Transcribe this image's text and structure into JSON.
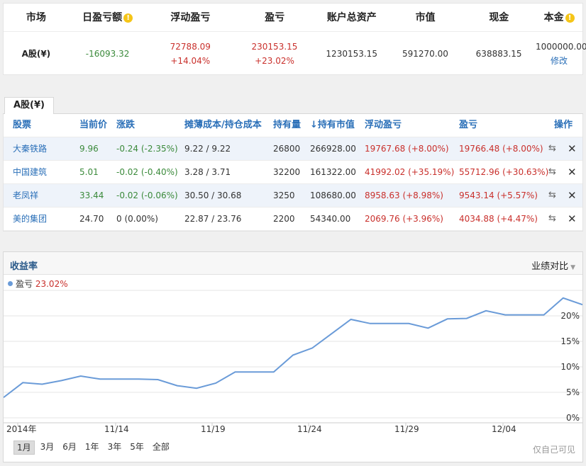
{
  "summary": {
    "headers": {
      "market": "市场",
      "daily_pl": "日盈亏额",
      "floating_pl": "浮动盈亏",
      "pl": "盈亏",
      "total_assets": "账户总资产",
      "market_value": "市值",
      "cash": "现金",
      "principal": "本金"
    },
    "info_icon": "!",
    "row": {
      "market": "A股(¥)",
      "daily_pl": "-16093.32",
      "floating_pl": "72788.09",
      "floating_pl_pct": "+14.04%",
      "pl": "230153.15",
      "pl_pct": "+23.02%",
      "total_assets": "1230153.15",
      "market_value": "591270.00",
      "cash": "638883.15",
      "principal": "1000000.00",
      "edit": "修改"
    }
  },
  "holdings": {
    "tab": "A股(¥)",
    "headers": [
      "股票",
      "当前价",
      "涨跌",
      "摊薄成本/持仓成本",
      "持有量",
      "持有市值",
      "浮动盈亏",
      "盈亏",
      "操作"
    ],
    "sort_icon": "↓",
    "rows": [
      {
        "name": "大秦铁路",
        "price": "9.96",
        "change": "-0.24 (-2.35%)",
        "cost": "9.22 / 9.22",
        "qty": "26800",
        "value": "266928.00",
        "floating": "19767.68 (+8.00%)",
        "pl": "19766.48 (+8.00%)"
      },
      {
        "name": "中国建筑",
        "price": "5.01",
        "change": "-0.02 (-0.40%)",
        "cost": "3.28 / 3.71",
        "qty": "32200",
        "value": "161322.00",
        "floating": "41992.02 (+35.19%)",
        "pl": "55712.96 (+30.63%)"
      },
      {
        "name": "老凤祥",
        "price": "33.44",
        "change": "-0.02 (-0.06%)",
        "cost": "30.50 / 30.68",
        "qty": "3250",
        "value": "108680.00",
        "floating": "8958.63 (+8.98%)",
        "pl": "9543.14 (+5.57%)"
      },
      {
        "name": "美的集团",
        "price": "24.70",
        "change": "0 (0.00%)",
        "cost": "22.87 / 23.76",
        "qty": "2200",
        "value": "54340.00",
        "floating": "2069.76 (+3.96%)",
        "pl": "4034.88 (+4.47%)"
      }
    ],
    "colors": {
      "up": "#c9302c",
      "down": "#3b8a3b",
      "flat": "#333333"
    },
    "icons": {
      "swap": "swap-icon",
      "delete": "close-icon"
    }
  },
  "chart_panel": {
    "title": "收益率",
    "compare_label": "业绩对比",
    "legend_name": "盈亏",
    "legend_value": "23.02%",
    "range_options": [
      "1月",
      "3月",
      "6月",
      "1年",
      "3年",
      "5年",
      "全部"
    ],
    "active_range": "1月",
    "private_note": "仅自己可见"
  },
  "chart_data": {
    "type": "line",
    "x_ticks": [
      "2014年",
      "11/14",
      "11/19",
      "11/24",
      "11/29",
      "12/04"
    ],
    "y_ticks": [
      "0%",
      "5%",
      "10%",
      "15%",
      "20%"
    ],
    "ylim": [
      0,
      25
    ],
    "grid": true,
    "series": [
      {
        "name": "盈亏",
        "color": "#6a9bd8",
        "values": [
          4.0,
          6.9,
          6.6,
          7.3,
          8.2,
          7.6,
          7.6,
          7.6,
          7.5,
          6.3,
          5.8,
          6.8,
          9.0,
          9.0,
          9.0,
          12.3,
          13.7,
          16.5,
          19.3,
          18.5,
          18.5,
          18.5,
          17.6,
          19.4,
          19.5,
          21.0,
          20.2,
          20.2,
          20.2,
          23.5,
          22.2
        ]
      }
    ]
  }
}
